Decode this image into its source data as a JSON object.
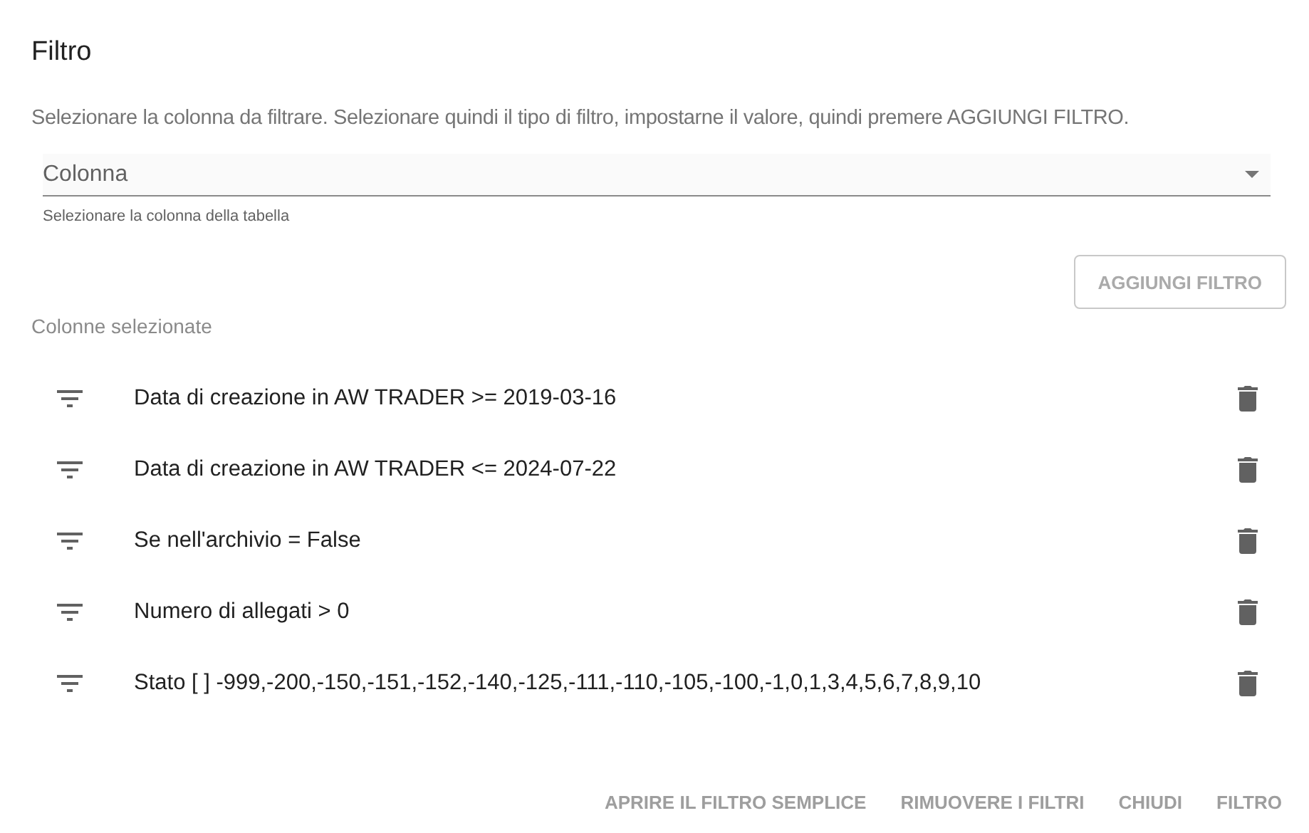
{
  "title": "Filtro",
  "description": "Selezionare la colonna da filtrare. Selezionare quindi il tipo di filtro, impostarne il valore, quindi premere AGGIUNGI FILTRO.",
  "column_select": {
    "placeholder": "Colonna",
    "hint": "Selezionare la colonna della tabella"
  },
  "add_button": {
    "label": "AGGIUNGI FILTRO",
    "disabled": true
  },
  "selected_heading": "Colonne selezionate",
  "filters": [
    {
      "text": "Data di creazione in AW TRADER >= 2019-03-16"
    },
    {
      "text": "Data di creazione in AW TRADER <= 2024-07-22"
    },
    {
      "text": "Se nell'archivio = False"
    },
    {
      "text": "Numero di allegati > 0"
    },
    {
      "text": "Stato [ ] -999,-200,-150,-151,-152,-140,-125,-111,-110,-105,-100,-1,0,1,3,4,5,6,7,8,9,10"
    }
  ],
  "footer_buttons": [
    "APRIRE IL FILTRO SEMPLICE",
    "RIMUOVERE I FILTRI",
    "CHIUDI",
    "FILTRO"
  ]
}
